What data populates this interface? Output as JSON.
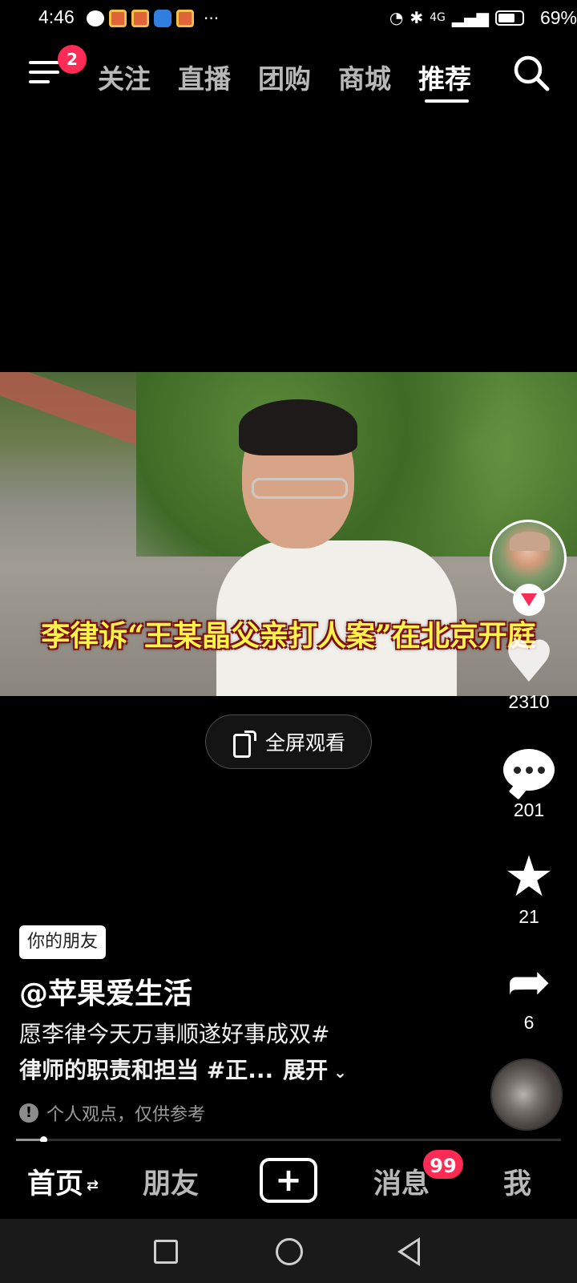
{
  "status_bar": {
    "time": "4:46",
    "more": "···",
    "battery_percent": "69%",
    "network": "4G"
  },
  "top_nav": {
    "menu_badge": "2",
    "tabs": [
      {
        "label": "关注",
        "active": false
      },
      {
        "label": "直播",
        "active": false
      },
      {
        "label": "团购",
        "active": false
      },
      {
        "label": "商城",
        "active": false
      },
      {
        "label": "推荐",
        "active": true
      }
    ]
  },
  "video": {
    "caption": "李律诉“王某晶父亲打人案”在北京开庭"
  },
  "fullscreen_button": {
    "label": "全屏观看"
  },
  "actions": {
    "likes": "2310",
    "comments": "201",
    "favorites": "21",
    "shares": "6"
  },
  "post": {
    "friend_tag": "你的朋友",
    "author": "@苹果爱生活",
    "description_line1": "愿李律今天万事顺遂好事成双#",
    "description_line2": "律师的职责和担当 #正...",
    "expand_label": "展开",
    "notice": "个人观点，仅供参考",
    "progress": 0.05
  },
  "bottom_tabs": {
    "home": "首页",
    "friends": "朋友",
    "messages": "消息",
    "messages_badge": "99",
    "me": "我"
  },
  "colors": {
    "accent": "#fe2c55",
    "caption_text": "#fff24a",
    "background": "#000000"
  },
  "icons": {
    "menu": "hamburger-icon",
    "search": "search-icon",
    "like": "heart-icon",
    "comment": "comment-bubble-icon",
    "favorite": "star-icon",
    "share": "share-arrow-icon",
    "create": "plus-icon"
  }
}
